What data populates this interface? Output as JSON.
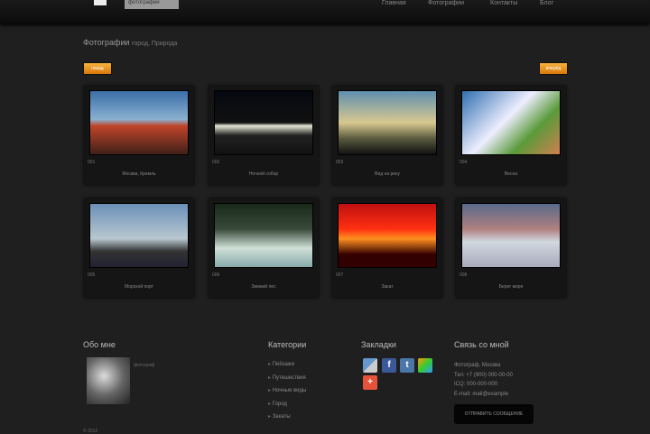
{
  "header": {
    "logo_text": "фотографии",
    "nav": [
      "Главная",
      "Фотографии",
      "Контакты",
      "Блог"
    ]
  },
  "page": {
    "title": "Фотографии",
    "subtitle": "город, Природа",
    "prev": "назад",
    "next": "вперёд"
  },
  "photos": [
    {
      "num": "001",
      "caption": "Москва, Кремль"
    },
    {
      "num": "002",
      "caption": "Ночной собор"
    },
    {
      "num": "003",
      "caption": "Вид на реку"
    },
    {
      "num": "004",
      "caption": "Весна"
    },
    {
      "num": "005",
      "caption": "Морской порт"
    },
    {
      "num": "006",
      "caption": "Зимний лес"
    },
    {
      "num": "007",
      "caption": "Закат"
    },
    {
      "num": "008",
      "caption": "Берег моря"
    }
  ],
  "footer": {
    "about_title": "Обо мне",
    "about_caption": "фотограф",
    "categories_title": "Категории",
    "categories": [
      "Пейзажи",
      "Путешествия",
      "Ночные виды",
      "Город",
      "Закаты"
    ],
    "bookmarks_title": "Закладки",
    "contact_title": "Связь со мной",
    "contact_lines": [
      "Фотограф, Москва",
      "Тел: +7 (900) 000-00-00",
      "ICQ: 000-000-000",
      "E-mail: mail@example"
    ],
    "contact_button": "ОТПРАВИТЬ СООБЩЕНИЕ",
    "copyright": "© 2012"
  }
}
